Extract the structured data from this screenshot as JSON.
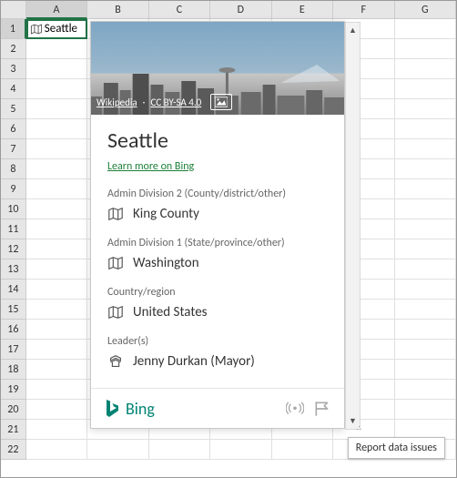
{
  "sheet": {
    "columns": [
      "A",
      "B",
      "C",
      "D",
      "E",
      "F",
      "G"
    ],
    "active_col": 0,
    "active_row": 0,
    "rows": 22,
    "selected_cell_value": "Seattle"
  },
  "card": {
    "hero": {
      "source_label": "Wikipedia",
      "license_label": "CC BY-SA 4.0"
    },
    "title": "Seattle",
    "learn_more_label": "Learn more on Bing",
    "fields": [
      {
        "label": "Admin Division 2 (County/district/other)",
        "value": "King County",
        "icon": "map"
      },
      {
        "label": "Admin Division 1 (State/province/other)",
        "value": "Washington",
        "icon": "map"
      },
      {
        "label": "Country/region",
        "value": "United States",
        "icon": "map"
      },
      {
        "label": "Leader(s)",
        "value": "Jenny Durkan (Mayor)",
        "icon": "leader"
      }
    ],
    "footer_brand": "Bing"
  },
  "tooltip": {
    "text": "Report data issues"
  }
}
